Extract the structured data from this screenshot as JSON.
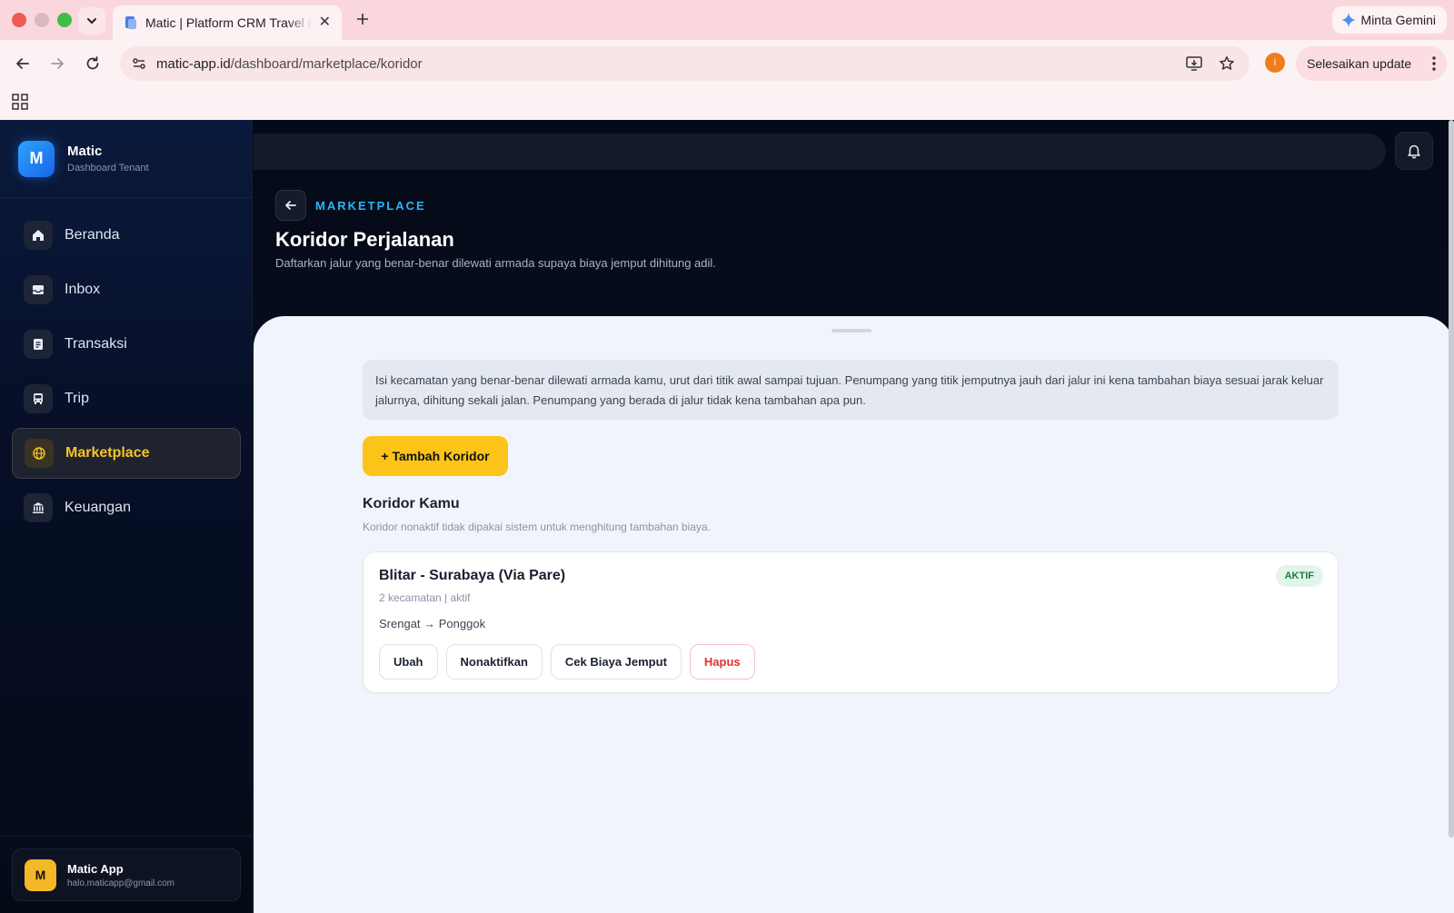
{
  "browser": {
    "tab_title": "Matic | Platform CRM Travel Dash",
    "url_host": "matic-app.id",
    "url_path": "/dashboard/marketplace/koridor",
    "gemini_label": "Minta Gemini",
    "update_label": "Selesaikan update",
    "profile_initial": "i"
  },
  "brand": {
    "logo_letter": "M",
    "name": "Matic",
    "subtitle": "Dashboard Tenant"
  },
  "sidebar": {
    "items": [
      {
        "label": "Beranda",
        "icon": "home-icon"
      },
      {
        "label": "Inbox",
        "icon": "inbox-icon"
      },
      {
        "label": "Transaksi",
        "icon": "document-icon"
      },
      {
        "label": "Trip",
        "icon": "bus-icon"
      },
      {
        "label": "Marketplace",
        "icon": "globe-icon",
        "active": true
      },
      {
        "label": "Keuangan",
        "icon": "bank-icon"
      }
    ]
  },
  "user": {
    "initial": "M",
    "name": "Matic App",
    "email": "halo.maticapp@gmail.com"
  },
  "header": {
    "eyebrow": "MARKETPLACE",
    "title": "Koridor Perjalanan",
    "subtitle": "Daftarkan jalur yang benar-benar dilewati armada supaya biaya jemput dihitung adil."
  },
  "info": {
    "text": "Isi kecamatan yang benar-benar dilewati armada kamu, urut dari titik awal sampai tujuan. Penumpang yang titik jemputnya jauh dari jalur ini kena tambahan biaya sesuai jarak keluar jalurnya, dihitung sekali jalan. Penumpang yang berada di jalur tidak kena tambahan apa pun."
  },
  "add_button": "+ Tambah Koridor",
  "section": {
    "title": "Koridor Kamu",
    "subtitle": "Koridor nonaktif tidak dipakai sistem untuk menghitung tambahan biaya."
  },
  "corridors": [
    {
      "name": "Blitar - Surabaya (Via Pare)",
      "meta": "2 kecamatan | aktif",
      "route": "Srengat → Ponggok",
      "status": "AKTIF",
      "actions": {
        "edit": "Ubah",
        "deactivate": "Nonaktifkan",
        "check_fee": "Cek Biaya Jemput",
        "delete": "Hapus"
      }
    }
  ],
  "colors": {
    "accent_yellow": "#fcc419",
    "accent_blue": "#29b6f6",
    "status_green": "#1e7a45",
    "danger_red": "#e03131"
  }
}
